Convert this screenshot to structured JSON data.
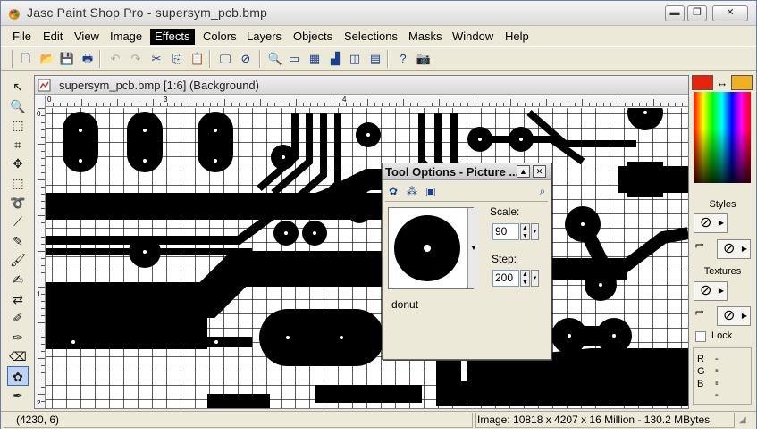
{
  "window": {
    "title": "Jasc Paint Shop Pro - supersym_pcb.bmp",
    "minimize_glyph": "▬",
    "maximize_glyph": "❐",
    "close_glyph": "✕"
  },
  "menu": {
    "items": [
      {
        "label": "File",
        "active": false
      },
      {
        "label": "Edit",
        "active": false
      },
      {
        "label": "View",
        "active": false
      },
      {
        "label": "Image",
        "active": false
      },
      {
        "label": "Effects",
        "active": true
      },
      {
        "label": "Colors",
        "active": false
      },
      {
        "label": "Layers",
        "active": false
      },
      {
        "label": "Objects",
        "active": false
      },
      {
        "label": "Selections",
        "active": false
      },
      {
        "label": "Masks",
        "active": false
      },
      {
        "label": "Window",
        "active": false
      },
      {
        "label": "Help",
        "active": false
      }
    ]
  },
  "toolbar": {
    "buttons": [
      {
        "icon": "new-file-icon",
        "glyph": "🗋",
        "disabled": false
      },
      {
        "icon": "open-folder-icon",
        "glyph": "📂",
        "disabled": false
      },
      {
        "icon": "save-icon",
        "glyph": "💾",
        "disabled": false
      },
      {
        "icon": "print-icon",
        "glyph": "🖶",
        "disabled": false
      },
      {
        "icon": "undo-icon",
        "glyph": "↶",
        "disabled": true
      },
      {
        "icon": "redo-icon",
        "glyph": "↷",
        "disabled": true
      },
      {
        "icon": "cut-icon",
        "glyph": "✂",
        "disabled": false
      },
      {
        "icon": "copy-icon",
        "glyph": "⎘",
        "disabled": false
      },
      {
        "icon": "paste-icon",
        "glyph": "📋",
        "disabled": true
      },
      {
        "icon": "monitor-icon",
        "glyph": "🖵",
        "disabled": false
      },
      {
        "icon": "no-entry-icon",
        "glyph": "⊘",
        "disabled": false
      },
      {
        "icon": "zoom-view-icon",
        "glyph": "🔍",
        "disabled": false
      },
      {
        "icon": "toolbar-toggle-icon",
        "glyph": "▭",
        "disabled": false
      },
      {
        "icon": "color-palette-icon",
        "glyph": "▦",
        "disabled": false
      },
      {
        "icon": "histogram-icon",
        "glyph": "▟",
        "disabled": false
      },
      {
        "icon": "layer-palette-icon",
        "glyph": "◫",
        "disabled": false
      },
      {
        "icon": "overview-window-icon",
        "glyph": "▤",
        "disabled": false
      },
      {
        "icon": "help-context-icon",
        "glyph": "?",
        "disabled": false
      },
      {
        "icon": "camera-capture-icon",
        "glyph": "📷",
        "disabled": false
      }
    ]
  },
  "tools": [
    {
      "icon": "arrow-pointer-icon",
      "glyph": "↖",
      "selected": false
    },
    {
      "icon": "zoom-icon",
      "glyph": "🔍",
      "selected": false
    },
    {
      "icon": "deformation-icon",
      "glyph": "⬚",
      "selected": false
    },
    {
      "icon": "crop-icon",
      "glyph": "⌗",
      "selected": false
    },
    {
      "icon": "move-icon",
      "glyph": "✥",
      "selected": false
    },
    {
      "icon": "selection-icon",
      "glyph": "⬚",
      "selected": false
    },
    {
      "icon": "freehand-lasso-icon",
      "glyph": "➰",
      "selected": false
    },
    {
      "icon": "magic-wand-icon",
      "glyph": "⟋",
      "selected": false
    },
    {
      "icon": "dropper-icon",
      "glyph": "✎",
      "selected": false
    },
    {
      "icon": "paint-brush-icon",
      "glyph": "🖌",
      "selected": false
    },
    {
      "icon": "clone-brush-icon",
      "glyph": "✍",
      "selected": false
    },
    {
      "icon": "color-replacer-icon",
      "glyph": "⇄",
      "selected": false
    },
    {
      "icon": "retouch-icon",
      "glyph": "✐",
      "selected": false
    },
    {
      "icon": "scratch-remover-icon",
      "glyph": "✑",
      "selected": false
    },
    {
      "icon": "eraser-icon",
      "glyph": "⌫",
      "selected": false
    },
    {
      "icon": "picture-tube-icon",
      "glyph": "✿",
      "selected": true
    },
    {
      "icon": "airbrush-icon",
      "glyph": "✒",
      "selected": false
    }
  ],
  "document": {
    "title": "supersym_pcb.bmp [1:6] (Background)",
    "ruler_h_numbers": [
      "0",
      "3",
      "4"
    ],
    "ruler_v_numbers": [
      "0",
      "1",
      "2"
    ]
  },
  "right_panel": {
    "foreground_color": "#e8220c",
    "background_color": "#f0b020",
    "styles_label": "Styles",
    "textures_label": "Textures",
    "lock_label": "Lock",
    "r_label": "R",
    "g_label": "G",
    "b_label": "B",
    "r_value": "--",
    "g_value": "--",
    "b_value": "--",
    "null_glyph": "⊘"
  },
  "tool_options": {
    "title": "Tool Options - Picture ...",
    "tube_name": "donut",
    "scale_label": "Scale:",
    "scale_value": "90",
    "step_label": "Step:",
    "step_value": "200"
  },
  "status": {
    "coords": "(4230, 6)",
    "image_info": "Image:  10818 x 4207 x 16 Million - 130.2 MBytes"
  }
}
